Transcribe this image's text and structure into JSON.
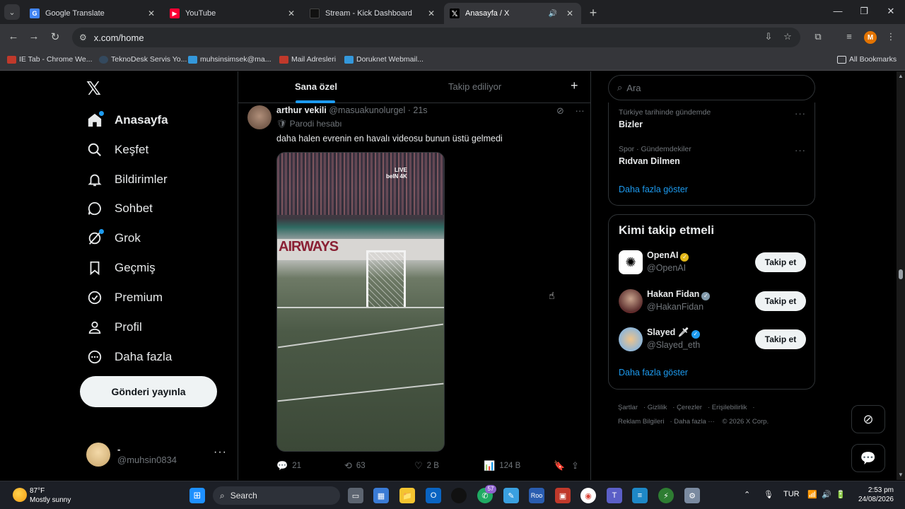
{
  "browser": {
    "tabs": [
      {
        "title": "Google Translate",
        "favicon_color": "#4285f4"
      },
      {
        "title": "YouTube",
        "favicon_color": "#ff0033"
      },
      {
        "title": "Stream - Kick Dashboard",
        "favicon_color": "#111111"
      },
      {
        "title": "Anasayfa / X",
        "favicon_color": "#000000",
        "active": true
      }
    ],
    "url": "x.com/home",
    "profile_initial": "M",
    "bookmarks": [
      "IE Tab - Chrome We...",
      "TeknoDesk Servis Yo...",
      "muhsinsimsek@ma...",
      "Mail Adresleri",
      "Doruknet Webmail..."
    ],
    "all_bookmarks": "All Bookmarks"
  },
  "x": {
    "nav": [
      {
        "label": "Anasayfa",
        "icon": "home-icon",
        "active": true,
        "dot": true
      },
      {
        "label": "Keşfet",
        "icon": "search-icon"
      },
      {
        "label": "Bildirimler",
        "icon": "bell-icon"
      },
      {
        "label": "Sohbet",
        "icon": "chat-icon"
      },
      {
        "label": "Grok",
        "icon": "grok-icon",
        "dot": true
      },
      {
        "label": "Geçmiş",
        "icon": "bookmark-icon"
      },
      {
        "label": "Premium",
        "icon": "premium-icon"
      },
      {
        "label": "Profil",
        "icon": "profile-icon"
      },
      {
        "label": "Daha fazla",
        "icon": "more-circle-icon"
      }
    ],
    "post_button": "Gönderi yayınla",
    "account": {
      "name": "-",
      "handle": "@muhsin0834"
    },
    "timeline_tabs": [
      "Sana özel",
      "Takip ediliyor"
    ],
    "tweet": {
      "name": "arthur vekili",
      "handle": "@masuakunolurgel",
      "time": "· 21s",
      "badge": "Parodi hesabı",
      "text": "daha halen evrenin en havalı videosu bunun üstü gelmedi",
      "media_board_text": "AIRWAYS",
      "media_live": "LIVE",
      "media_channel": "beIN 4K",
      "replies": "21",
      "reposts": "63",
      "likes": "2 B",
      "views": "124 B"
    },
    "search_placeholder": "Ara",
    "trends": [
      {
        "meta": "Türkiye tarihinde gündemde",
        "name": "Bizler"
      },
      {
        "meta": "Spor · Gündemdekiler",
        "name": "Rıdvan Dilmen"
      }
    ],
    "show_more": "Daha fazla göster",
    "who_to_follow_title": "Kimi takip etmeli",
    "suggestions": [
      {
        "name": "OpenAI",
        "handle": "@OpenAI",
        "badge_color": "#e2b719",
        "emoji": ""
      },
      {
        "name": "Hakan Fidan",
        "handle": "@HakanFidan",
        "badge_color": "#829aab",
        "emoji": ""
      },
      {
        "name": "Slayed",
        "handle": "@Slayed_eth",
        "badge_color": "#1d9bf0",
        "emoji": "🗡"
      }
    ],
    "follow_label": "Takip et",
    "footer": [
      "Şartlar",
      "Gizlilik",
      "Çerezler",
      "Erişilebilirlik",
      "Reklam Bilgileri",
      "Daha fazla ···",
      "© 2026 X Corp."
    ]
  },
  "taskbar": {
    "weather_temp": "87°F",
    "weather_desc": "Mostly sunny",
    "search": "Search",
    "chat_badge": "57",
    "lang": "TUR",
    "time": "2:53 pm",
    "date": "24/08/2026"
  }
}
